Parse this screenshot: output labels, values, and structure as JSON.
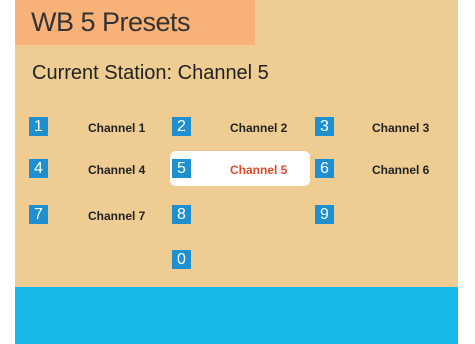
{
  "header": {
    "title": "WB 5 Presets"
  },
  "station": {
    "text": "Current Station: Channel 5"
  },
  "presets": [
    {
      "key": "1",
      "label": "Channel 1"
    },
    {
      "key": "2",
      "label": "Channel 2"
    },
    {
      "key": "3",
      "label": "Channel 3"
    },
    {
      "key": "4",
      "label": "Channel 4"
    },
    {
      "key": "5",
      "label": "Channel 5",
      "selected": true
    },
    {
      "key": "6",
      "label": "Channel 6"
    },
    {
      "key": "7",
      "label": "Channel 7"
    },
    {
      "key": "8",
      "label": ""
    },
    {
      "key": "9",
      "label": ""
    },
    {
      "key": "0",
      "label": ""
    }
  ],
  "colors": {
    "panel": "#efcc92",
    "title_bar": "#f8b176",
    "key": "#1e8fd0",
    "selected_label": "#e04a2a",
    "bottom_bar": "#18b8e8"
  }
}
